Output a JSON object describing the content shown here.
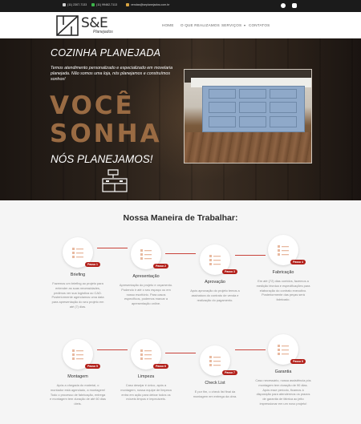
{
  "topbar": {
    "phone1": "(11) 2307-7133",
    "phone2": "(11) 99462-7113",
    "email": "vendas@seplanejados.com.br",
    "social": [
      "facebook-icon",
      "instagram-icon"
    ]
  },
  "header": {
    "logo_text": "S&E",
    "logo_sub": "Planejados",
    "nav": [
      "HOME",
      "O QUE REALIZAMOS",
      "SERVIÇOS",
      "CONTATOS"
    ]
  },
  "hero": {
    "title": "COZINHA PLANEJADA",
    "text": "Temos atendimento personalizado e especializado em movelaria planejada. Não somos uma loja, nós planejamos e construímos sonhos!",
    "big1": "VOCÊ",
    "big2": "SONHA",
    "sub": "NÓS PLANEJAMOS!"
  },
  "process": {
    "title": "Nossa Maneira de Trabalhar:",
    "steps": [
      {
        "badge": "Passo 1",
        "title": "Briefing",
        "desc": "Fazemos um briefing ao projeto para entender as suas necessidades, pedimos ver sua logística ou CAD. Posteriormente agendamos uma data para apresentação do seu projeto em até (7) dias."
      },
      {
        "badge": "Passo 2",
        "title": "Apresentação",
        "desc": "Apresentação do projeto e orçamento. Podendo ir até o seu espaço ou em nosso escritório. Para casos específicos, podemos marcar a apresentação online."
      },
      {
        "badge": "Passo 3",
        "title": "Aprovação",
        "desc": "Após aprovação do projeto temos a assinatura do contrato de venda e realização do pagamento."
      },
      {
        "badge": "Passo 4",
        "title": "Fabricação",
        "desc": "Em até (72) dias corridos, fazemos a medição técnica e especificações para elaboração do contrato executivo. Posteriormente das peças será fabricado."
      },
      {
        "badge": "Passo 5",
        "title": "Montagem",
        "desc": "Após a chegada do material, o montador está agendado, a montagem! Todo o processo de fabricação, entrega e montagem tem duração de até 60 dias úteis."
      },
      {
        "badge": "Passo 6",
        "title": "Limpeza",
        "desc": "Caso desejar é único, após a montagem, nossa equipe de limpeza entra em ação para deixar todos os móveis limpos e impecáveis."
      },
      {
        "badge": "Passo 7",
        "title": "Check List",
        "desc": "E por fim, o check list final da montagem em entrega da obra."
      },
      {
        "badge": "Passo 8",
        "title": "Garantia",
        "desc": "Caso necessário, nossa assistência pós montagem tem duração de 90 dias. Após esse período, ficamos à disposição para atendermos os prazos de garantia de fábrica ao jeito impressionar em um novo projeto!"
      }
    ]
  },
  "colors": {
    "accent": "#b2201a",
    "hero_brown": "#9a6b43",
    "topbar": "#1b1b1b"
  }
}
